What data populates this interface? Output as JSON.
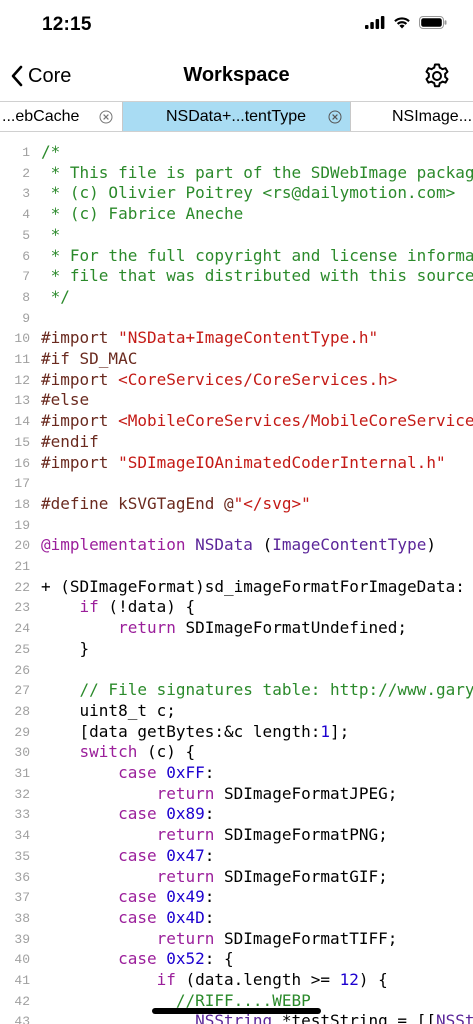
{
  "status": {
    "time": "12:15"
  },
  "nav": {
    "back_label": "Core",
    "title": "Workspace"
  },
  "tabs": [
    {
      "label": "...ebCache"
    },
    {
      "label": "NSData+...tentType",
      "active": true
    },
    {
      "label": "NSImage..."
    }
  ],
  "editor": {
    "lines": [
      {
        "n": "1",
        "tokens": [
          [
            "c-comment",
            "/*"
          ]
        ]
      },
      {
        "n": "2",
        "tokens": [
          [
            "c-comment",
            " * This file is part of the SDWebImage package."
          ]
        ]
      },
      {
        "n": "3",
        "tokens": [
          [
            "c-comment",
            " * (c) Olivier Poitrey <rs@dailymotion.com>"
          ]
        ]
      },
      {
        "n": "4",
        "tokens": [
          [
            "c-comment",
            " * (c) Fabrice Aneche"
          ]
        ]
      },
      {
        "n": "5",
        "tokens": [
          [
            "c-comment",
            " *"
          ]
        ]
      },
      {
        "n": "6",
        "tokens": [
          [
            "c-comment",
            " * For the full copyright and license information"
          ]
        ]
      },
      {
        "n": "7",
        "tokens": [
          [
            "c-comment",
            " * file that was distributed with this source"
          ]
        ]
      },
      {
        "n": "8",
        "tokens": [
          [
            "c-comment",
            " */"
          ]
        ]
      },
      {
        "n": "9",
        "tokens": []
      },
      {
        "n": "10",
        "tokens": [
          [
            "c-prep",
            "#import "
          ],
          [
            "c-str",
            "\"NSData+ImageContentType.h\""
          ]
        ]
      },
      {
        "n": "11",
        "tokens": [
          [
            "c-prep",
            "#if SD_MAC"
          ]
        ]
      },
      {
        "n": "12",
        "tokens": [
          [
            "c-prep",
            "#import "
          ],
          [
            "c-str",
            "<CoreServices/CoreServices.h>"
          ]
        ]
      },
      {
        "n": "13",
        "tokens": [
          [
            "c-prep",
            "#else"
          ]
        ]
      },
      {
        "n": "14",
        "tokens": [
          [
            "c-prep",
            "#import "
          ],
          [
            "c-str",
            "<MobileCoreServices/MobileCoreServices.h>"
          ]
        ]
      },
      {
        "n": "15",
        "tokens": [
          [
            "c-prep",
            "#endif"
          ]
        ]
      },
      {
        "n": "16",
        "tokens": [
          [
            "c-prep",
            "#import "
          ],
          [
            "c-str",
            "\"SDImageIOAnimatedCoderInternal.h\""
          ]
        ]
      },
      {
        "n": "17",
        "tokens": []
      },
      {
        "n": "18",
        "tokens": [
          [
            "c-prep",
            "#define kSVGTagEnd @"
          ],
          [
            "c-str",
            "\"</svg>\""
          ]
        ]
      },
      {
        "n": "19",
        "tokens": []
      },
      {
        "n": "20",
        "tokens": [
          [
            "c-kw",
            "@implementation"
          ],
          [
            "c-plain",
            " "
          ],
          [
            "c-type",
            "NSData"
          ],
          [
            "c-plain",
            " ("
          ],
          [
            "c-type",
            "ImageContentType"
          ],
          [
            "c-plain",
            ")"
          ]
        ]
      },
      {
        "n": "21",
        "tokens": []
      },
      {
        "n": "22",
        "tokens": [
          [
            "c-plain",
            "+ (SDImageFormat)sd_imageFormatForImageData:"
          ]
        ]
      },
      {
        "n": "23",
        "tokens": [
          [
            "c-plain",
            "    "
          ],
          [
            "c-kw",
            "if"
          ],
          [
            "c-plain",
            " (!data) {"
          ]
        ]
      },
      {
        "n": "24",
        "tokens": [
          [
            "c-plain",
            "        "
          ],
          [
            "c-kw",
            "return"
          ],
          [
            "c-plain",
            " SDImageFormatUndefined;"
          ]
        ]
      },
      {
        "n": "25",
        "tokens": [
          [
            "c-plain",
            "    }"
          ]
        ]
      },
      {
        "n": "26",
        "tokens": []
      },
      {
        "n": "27",
        "tokens": [
          [
            "c-comment",
            "    // File signatures table: http://www.garykessler"
          ]
        ]
      },
      {
        "n": "28",
        "tokens": [
          [
            "c-plain",
            "    uint8_t c;"
          ]
        ]
      },
      {
        "n": "29",
        "tokens": [
          [
            "c-plain",
            "    [data getBytes:&c length:"
          ],
          [
            "c-num",
            "1"
          ],
          [
            "c-plain",
            "];"
          ]
        ]
      },
      {
        "n": "30",
        "tokens": [
          [
            "c-plain",
            "    "
          ],
          [
            "c-kw",
            "switch"
          ],
          [
            "c-plain",
            " (c) {"
          ]
        ]
      },
      {
        "n": "31",
        "tokens": [
          [
            "c-plain",
            "        "
          ],
          [
            "c-kw",
            "case"
          ],
          [
            "c-plain",
            " "
          ],
          [
            "c-num",
            "0xFF"
          ],
          [
            "c-plain",
            ":"
          ]
        ]
      },
      {
        "n": "32",
        "tokens": [
          [
            "c-plain",
            "            "
          ],
          [
            "c-kw",
            "return"
          ],
          [
            "c-plain",
            " SDImageFormatJPEG;"
          ]
        ]
      },
      {
        "n": "33",
        "tokens": [
          [
            "c-plain",
            "        "
          ],
          [
            "c-kw",
            "case"
          ],
          [
            "c-plain",
            " "
          ],
          [
            "c-num",
            "0x89"
          ],
          [
            "c-plain",
            ":"
          ]
        ]
      },
      {
        "n": "34",
        "tokens": [
          [
            "c-plain",
            "            "
          ],
          [
            "c-kw",
            "return"
          ],
          [
            "c-plain",
            " SDImageFormatPNG;"
          ]
        ]
      },
      {
        "n": "35",
        "tokens": [
          [
            "c-plain",
            "        "
          ],
          [
            "c-kw",
            "case"
          ],
          [
            "c-plain",
            " "
          ],
          [
            "c-num",
            "0x47"
          ],
          [
            "c-plain",
            ":"
          ]
        ]
      },
      {
        "n": "36",
        "tokens": [
          [
            "c-plain",
            "            "
          ],
          [
            "c-kw",
            "return"
          ],
          [
            "c-plain",
            " SDImageFormatGIF;"
          ]
        ]
      },
      {
        "n": "37",
        "tokens": [
          [
            "c-plain",
            "        "
          ],
          [
            "c-kw",
            "case"
          ],
          [
            "c-plain",
            " "
          ],
          [
            "c-num",
            "0x49"
          ],
          [
            "c-plain",
            ":"
          ]
        ]
      },
      {
        "n": "38",
        "tokens": [
          [
            "c-plain",
            "        "
          ],
          [
            "c-kw",
            "case"
          ],
          [
            "c-plain",
            " "
          ],
          [
            "c-num",
            "0x4D"
          ],
          [
            "c-plain",
            ":"
          ]
        ]
      },
      {
        "n": "39",
        "tokens": [
          [
            "c-plain",
            "            "
          ],
          [
            "c-kw",
            "return"
          ],
          [
            "c-plain",
            " SDImageFormatTIFF;"
          ]
        ]
      },
      {
        "n": "40",
        "tokens": [
          [
            "c-plain",
            "        "
          ],
          [
            "c-kw",
            "case"
          ],
          [
            "c-plain",
            " "
          ],
          [
            "c-num",
            "0x52"
          ],
          [
            "c-plain",
            ": {"
          ]
        ]
      },
      {
        "n": "41",
        "tokens": [
          [
            "c-plain",
            "            "
          ],
          [
            "c-kw",
            "if"
          ],
          [
            "c-plain",
            " (data.length >= "
          ],
          [
            "c-num",
            "12"
          ],
          [
            "c-plain",
            ") {"
          ]
        ]
      },
      {
        "n": "42",
        "tokens": [
          [
            "c-comment",
            "              //RIFF....WEBP"
          ]
        ]
      },
      {
        "n": "43",
        "tokens": [
          [
            "c-plain",
            "                "
          ],
          [
            "c-type",
            "NSString"
          ],
          [
            "c-plain",
            " *testString = [["
          ],
          [
            "c-type",
            "NSString"
          ]
        ]
      }
    ]
  },
  "colors": {
    "active_tab": "#a9dcf3",
    "comment": "#2b8a2b",
    "preprocessor": "#6a2a1f",
    "string": "#c41a16",
    "keyword": "#9b1f9b",
    "number": "#1c00cf",
    "type": "#5b2699"
  },
  "icons": {
    "back": "chevron-left-icon",
    "settings": "gear-icon",
    "tab_close": "close-circle-icon",
    "signal": "cellular-signal-icon",
    "wifi": "wifi-icon",
    "battery": "battery-icon"
  }
}
